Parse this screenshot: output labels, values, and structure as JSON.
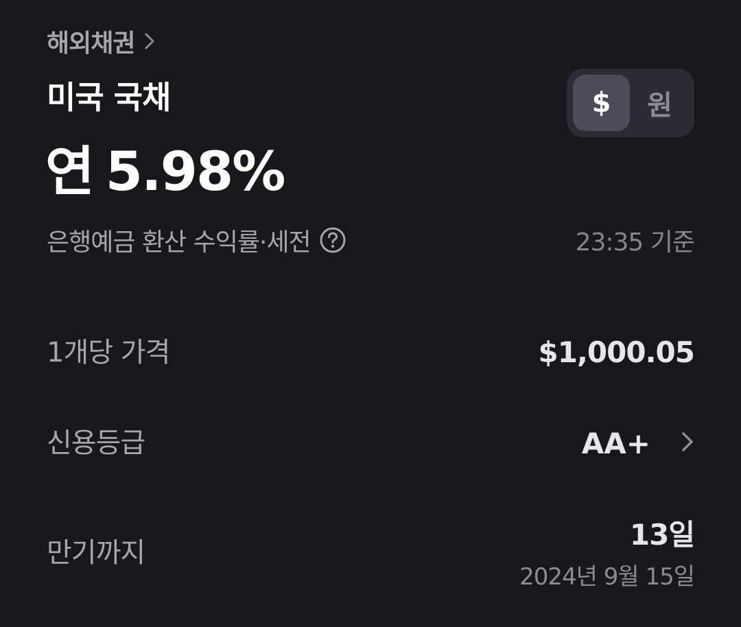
{
  "header": {
    "breadcrumb": "해외채권",
    "title": "미국 국채"
  },
  "rate": {
    "prefix": "연",
    "value": "5.98%",
    "description": "은행예금 환산 수익률·세전",
    "help_icon": "question-circle-icon",
    "as_of": "23:35 기준"
  },
  "currency_toggle": {
    "options": [
      "$",
      "원"
    ],
    "selected": "$"
  },
  "details": {
    "price_label": "1개당 가격",
    "price_value": "$1,000.05",
    "rating_label": "신용등급",
    "rating_value": "AA+",
    "maturity_label": "만기까지",
    "maturity_value": "13일",
    "maturity_date": "2024년 9월 15일"
  },
  "colors": {
    "background": "#17171c",
    "primary_text": "#ffffff",
    "secondary_text": "#a6a6ad",
    "toggle_bg": "#2c2c35",
    "toggle_active": "#4d4d59"
  }
}
